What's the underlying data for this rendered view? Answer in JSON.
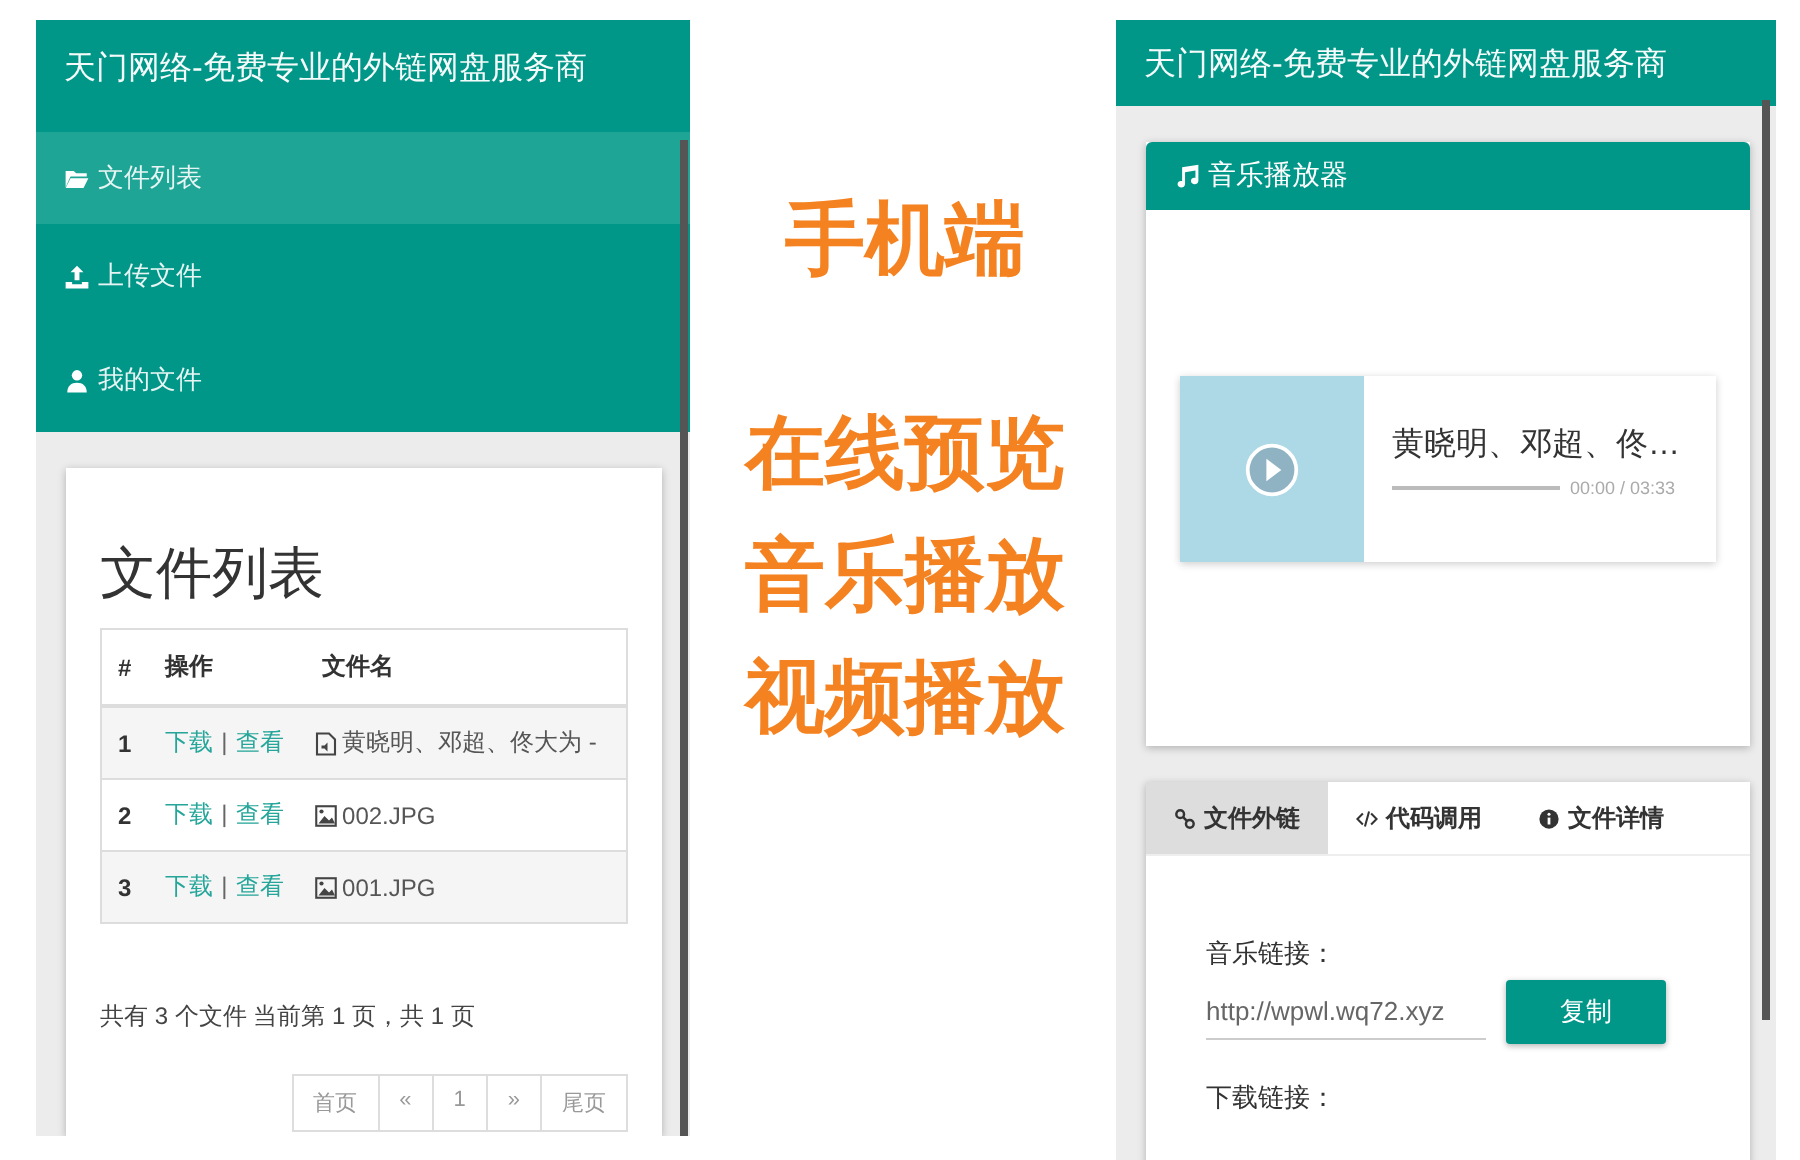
{
  "left_phone": {
    "header": {
      "title": "天门网络-免费专业的外链网盘服务商"
    },
    "menu": [
      {
        "label": "文件列表",
        "selected": true
      },
      {
        "label": "上传文件",
        "selected": false
      },
      {
        "label": "我的文件",
        "selected": false
      }
    ],
    "panel": {
      "title": "文件列表",
      "table": {
        "columns": [
          "#",
          "操作",
          "文件名"
        ],
        "rows": [
          {
            "index": "1",
            "actions": [
              "下载",
              "|",
              "查看"
            ],
            "kind": "audio",
            "name": "黄晓明、邓超、佟大为 -"
          },
          {
            "index": "2",
            "actions": [
              "下载",
              "|",
              "查看"
            ],
            "kind": "image",
            "name": "002.JPG"
          },
          {
            "index": "3",
            "actions": [
              "下载",
              "|",
              "查看"
            ],
            "kind": "image",
            "name": "001.JPG"
          }
        ]
      },
      "summary": "共有 3 个文件  当前第 1 页，共 1 页",
      "pagination": [
        "首页",
        "«",
        "1",
        "»",
        "尾页"
      ]
    }
  },
  "promo": {
    "headline": "手机端",
    "features": [
      "在线预览",
      "音乐播放",
      "视频播放"
    ]
  },
  "right_phone": {
    "header": {
      "title": "天门网络-免费专业的外链网盘服务商"
    },
    "player": {
      "title": "音乐播放器",
      "track": "黄晓明、邓超、佟…",
      "time": "00:00 / 03:33"
    },
    "tabs": [
      {
        "label": "文件外链",
        "selected": true
      },
      {
        "label": "代码调用",
        "selected": false
      },
      {
        "label": "文件详情",
        "selected": false
      }
    ],
    "link": {
      "label": "音乐链接：",
      "value": "http://wpwl.wq72.xyz",
      "button": "复制"
    },
    "next_label": "下载链接："
  }
}
